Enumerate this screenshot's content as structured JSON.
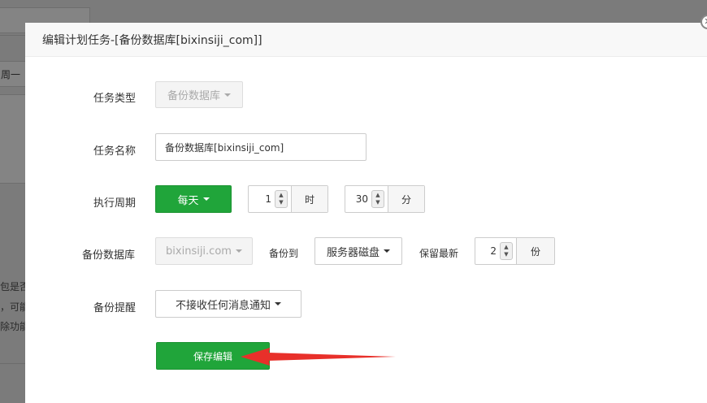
{
  "background": {
    "dropdown_text": "周一",
    "text_lines": [
      "包是否",
      "，可能",
      "除功能"
    ]
  },
  "modal": {
    "title": "编辑计划任务-[备份数据库[bixinsiji_com]]",
    "close_icon": "close-icon"
  },
  "form": {
    "task_type": {
      "label": "任务类型",
      "value": "备份数据库"
    },
    "task_name": {
      "label": "任务名称",
      "value": "备份数据库[bixinsiji_com]"
    },
    "cycle": {
      "label": "执行周期",
      "period": "每天",
      "hour_value": "1",
      "hour_unit": "时",
      "minute_value": "30",
      "minute_unit": "分"
    },
    "database": {
      "label": "备份数据库",
      "value": "bixinsiji.com",
      "backup_to_label": "备份到",
      "backup_to_value": "服务器磁盘",
      "keep_label": "保留最新",
      "keep_value": "2",
      "keep_unit": "份"
    },
    "notify": {
      "label": "备份提醒",
      "value": "不接收任何消息通知"
    },
    "save_label": "保存编辑"
  },
  "colors": {
    "primary_green": "#20a53a",
    "annotation_arrow": "#e8302a"
  }
}
